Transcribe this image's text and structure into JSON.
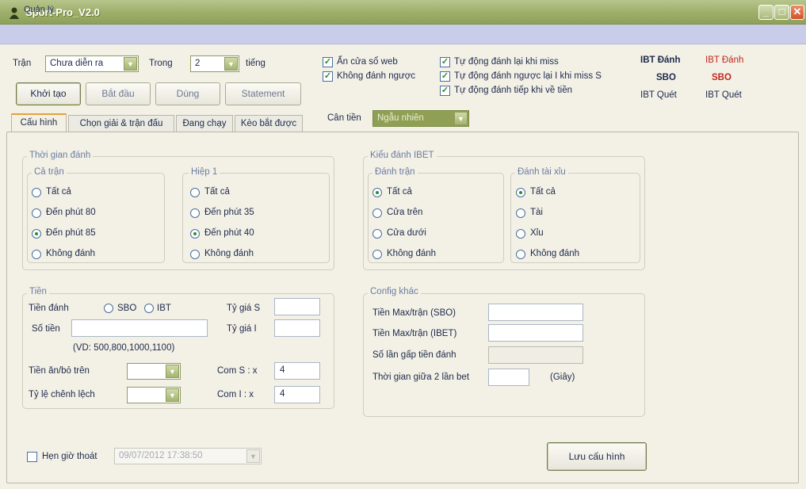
{
  "window": {
    "title": "Sport-Pro_V2.0"
  },
  "menu": {
    "item": "Quản lý"
  },
  "toolbar": {
    "tran_label": "Trận",
    "tran_value": "Chưa diễn ra",
    "trong_label": "Trong",
    "trong_value": "2",
    "tieng_label": "tiếng",
    "btn_khoitao": "Khởi tạo",
    "btn_batdau": "Bắt đầu",
    "btn_dung": "Dùng",
    "btn_statement": "Statement",
    "chk_an_cua_so": "Ẩn cửa sổ web",
    "chk_khong_danh_nguoc": "Không đánh ngược",
    "chk_tu_dong_miss": "Tự động đánh lại khi miss",
    "chk_tu_dong_nguoc": "Tự động đánh ngược lại I khi miss S",
    "chk_tu_dong_tiep": "Tự động đánh tiếp khi về tiền",
    "can_tien_label": "Cân tiền",
    "can_tien_value": "Ngẫu nhiên"
  },
  "status": {
    "ibt_danh_1": "IBT Đánh",
    "ibt_danh_2": "IBT Đánh",
    "sbo_1": "SBO",
    "sbo_2": "SBO",
    "ibt_quet_1": "IBT Quét",
    "ibt_quet_2": "IBT Quét"
  },
  "tabs": [
    "Cấu hình",
    "Chọn giải & trận đấu",
    "Đang chạy",
    "Kèo bắt được"
  ],
  "thoi_gian": {
    "title": "Thời gian đánh",
    "ca_tran": {
      "title": "Cả trận",
      "options": [
        "Tất cả",
        "Đến phút 80",
        "Đến phút 85",
        "Không đánh"
      ],
      "selected": 2
    },
    "hiep1": {
      "title": "Hiệp 1",
      "options": [
        "Tất cả",
        "Đến phút 35",
        "Đến phút 40",
        "Không đánh"
      ],
      "selected": 2
    }
  },
  "kieu_danh": {
    "title": "Kiểu đánh IBET",
    "danh_tran": {
      "title": "Đánh trận",
      "options": [
        "Tất cả",
        "Cửa trên",
        "Cửa dưới",
        "Không đánh"
      ],
      "selected": 0
    },
    "tai_xiu": {
      "title": "Đánh tài xỉu",
      "options": [
        "Tất cả",
        "Tài",
        "Xỉu",
        "Không đánh"
      ],
      "selected": 0
    }
  },
  "tien": {
    "title": "Tiền",
    "tien_danh_label": "Tiền đánh",
    "opt_sbo": "SBO",
    "opt_ibt": "IBT",
    "so_tien_label": "Số tiền",
    "so_tien_value": "",
    "so_tien_hint": "(VD: 500,800,1000,1100)",
    "ty_gia_s_label": "Tỷ giá S",
    "ty_gia_i_label": "Tỷ giá I",
    "tien_an_bo_label": "Tiền ăn/bỏ trên",
    "ty_le_label": "Tỷ lệ chênh lệch",
    "com_s_label": "Com S : x",
    "com_s_value": "4",
    "com_i_label": "Com I :  x",
    "com_i_value": "4"
  },
  "config": {
    "title": "Config khác",
    "max_sbo_label": "Tiền Max/trận (SBO)",
    "max_ibet_label": "Tiền Max/trận (IBET)",
    "so_lan_label": "Số lần gấp tiền đánh",
    "thoi_gian_label": "Thời gian giữa 2 lần bet",
    "giay_label": "(Giây)"
  },
  "footer": {
    "hen_gio_label": "Hẹn giờ thoát",
    "hen_gio_value": "09/07/2012 17:38:50",
    "luu_button": "Lưu cấu hình"
  }
}
